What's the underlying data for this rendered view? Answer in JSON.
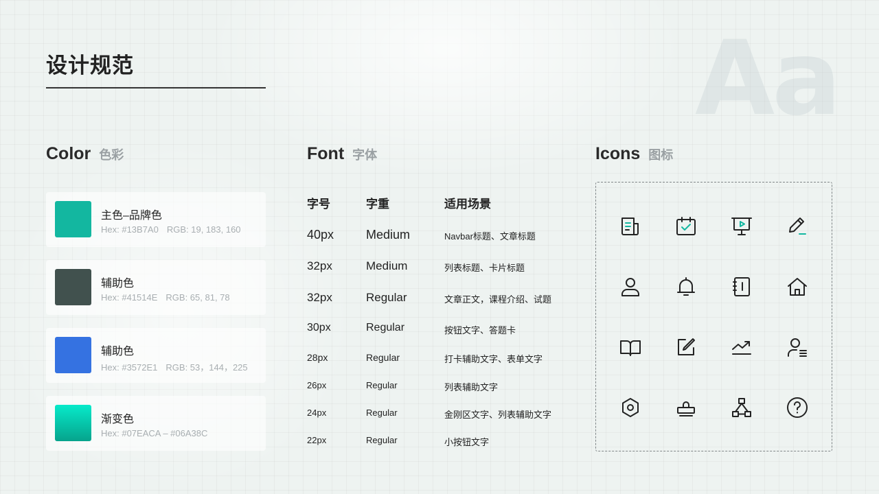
{
  "watermark": "Aa",
  "page_title": "设计规范",
  "sections": {
    "color": {
      "en": "Color",
      "zh": "色彩"
    },
    "font": {
      "en": "Font",
      "zh": "字体"
    },
    "icons": {
      "en": "Icons",
      "zh": "图标"
    }
  },
  "colors": [
    {
      "name": "主色–品牌色",
      "hex": "Hex: #13B7A0",
      "rgb": "RGB: 19, 183, 160",
      "swatch": "#13B7A0"
    },
    {
      "name": "辅助色",
      "hex": "Hex: #41514E",
      "rgb": "RGB: 65, 81, 78",
      "swatch": "#41514E"
    },
    {
      "name": "辅助色",
      "hex": "Hex: #3572E1",
      "rgb": "RGB: 53，144，225",
      "swatch": "#3572E1"
    },
    {
      "name": "渐变色",
      "hex": "Hex: #07EACA – #06A38C",
      "rgb": "",
      "swatch_from": "#07EACA",
      "swatch_to": "#06A38C"
    }
  ],
  "font_table": {
    "headers": [
      "字号",
      "字重",
      "适用场景"
    ],
    "rows": [
      {
        "size": "40px",
        "weight": "Medium",
        "usage": "Navbar标题、文章标题"
      },
      {
        "size": "32px",
        "weight": "Medium",
        "usage": "列表标题、卡片标题"
      },
      {
        "size": "32px",
        "weight": "Regular",
        "usage": "文章正文，课程介绍、试题"
      },
      {
        "size": "30px",
        "weight": "Regular",
        "usage": "按钮文字、答题卡"
      },
      {
        "size": "28px",
        "weight": "Regular",
        "usage": "打卡辅助文字、表单文字"
      },
      {
        "size": "26px",
        "weight": "Regular",
        "usage": "列表辅助文字"
      },
      {
        "size": "24px",
        "weight": "Regular",
        "usage": "金刚区文字、列表辅助文字"
      },
      {
        "size": "22px",
        "weight": "Regular",
        "usage": "小按钮文字"
      }
    ]
  },
  "icons": [
    "document-icon",
    "calendar-check-icon",
    "presentation-play-icon",
    "edit-pen-icon",
    "user-icon",
    "bell-icon",
    "notebook-icon",
    "home-icon",
    "book-open-icon",
    "edit-square-icon",
    "trend-up-icon",
    "user-list-icon",
    "settings-hexagon-icon",
    "stamp-icon",
    "hierarchy-icon",
    "help-circle-icon"
  ],
  "accent_color": "#13B7A0"
}
